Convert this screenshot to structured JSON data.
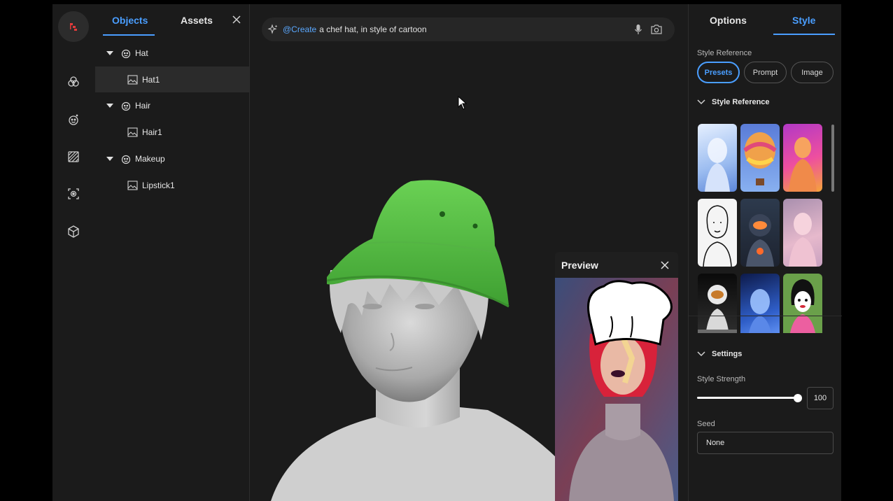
{
  "objects_panel": {
    "tabs": [
      "Objects",
      "Assets"
    ],
    "active_tab": "Objects",
    "tree": [
      {
        "label": "Hat",
        "type": "group"
      },
      {
        "label": "Hat1",
        "type": "asset",
        "selected": true
      },
      {
        "label": "Hair",
        "type": "group"
      },
      {
        "label": "Hair1",
        "type": "asset"
      },
      {
        "label": "Makeup",
        "type": "group"
      },
      {
        "label": "Lipstick1",
        "type": "asset"
      }
    ]
  },
  "rail": {
    "icons": [
      "logo-icon",
      "layers-icon",
      "face-icon",
      "pattern-icon",
      "focus-icon",
      "cube-icon"
    ]
  },
  "viewport": {
    "prompt": {
      "mention": "@Create",
      "text": "a chef hat, in style of cartoon"
    },
    "preview": {
      "title": "Preview"
    }
  },
  "right_panel": {
    "tabs": [
      "Options",
      "Style"
    ],
    "active_tab": "Style",
    "style_reference_label": "Style Reference",
    "pills": [
      "Presets",
      "Prompt",
      "Image"
    ],
    "active_pill": "Presets",
    "section_style_reference": "Style Reference",
    "thumbnails": [
      "white-figure",
      "balloon",
      "pink-statue",
      "sketch-girl",
      "astronaut-glow",
      "pink-figure",
      "astronaut-moon",
      "blue-face",
      "cartoon-girl"
    ],
    "section_settings": "Settings",
    "style_strength_label": "Style Strength",
    "style_strength_value": "100",
    "style_strength_fraction": 1.0,
    "seed_label": "Seed",
    "seed_value": "None"
  },
  "colors": {
    "accent": "#4a9eff",
    "panel_bg": "#1b1b1b",
    "hat_green": "#5bc447"
  }
}
